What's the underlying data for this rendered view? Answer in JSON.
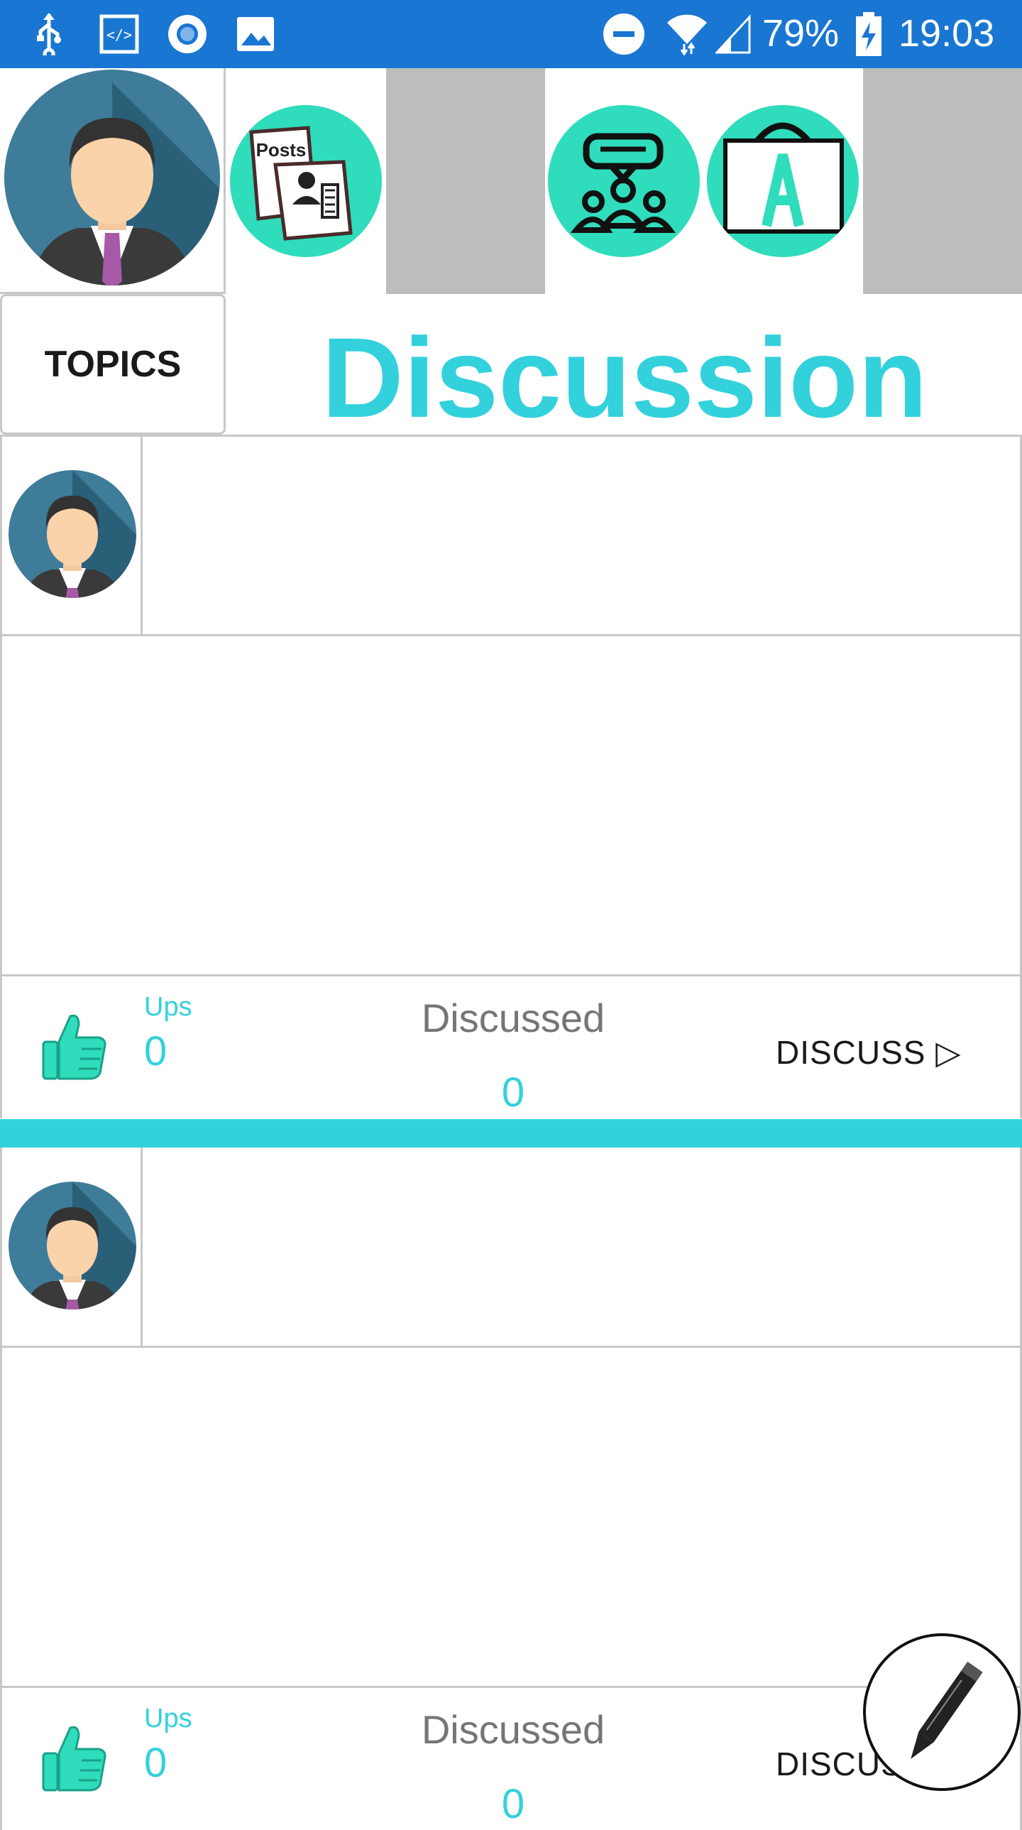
{
  "status_bar": {
    "battery": "79%",
    "time": "19:03",
    "icons": [
      "usb-icon",
      "code-icon",
      "record-icon",
      "image-icon",
      "dnd-icon",
      "wifi-icon",
      "signal-icon",
      "battery-charging-icon"
    ]
  },
  "header": {
    "topics_label": "TOPICS",
    "title": "Discussion",
    "actions": [
      "posts-icon",
      "group-chat-icon",
      "board-a-icon"
    ]
  },
  "posts": [
    {
      "ups_label": "Ups",
      "ups_count": "0",
      "discussed_label": "Discussed",
      "discussed_count": "0",
      "discuss_label": "DISCUSS ▷"
    },
    {
      "ups_label": "Ups",
      "ups_count": "0",
      "discussed_label": "Discussed",
      "discussed_count": "0",
      "discuss_label": "DISCUSS ▷"
    }
  ],
  "colors": {
    "status_bar": "#1976d2",
    "accent": "#33d1dc",
    "circle_green": "#2fdcbb",
    "gray_block": "#bdbdbd",
    "divider": "#c8c8c8"
  }
}
